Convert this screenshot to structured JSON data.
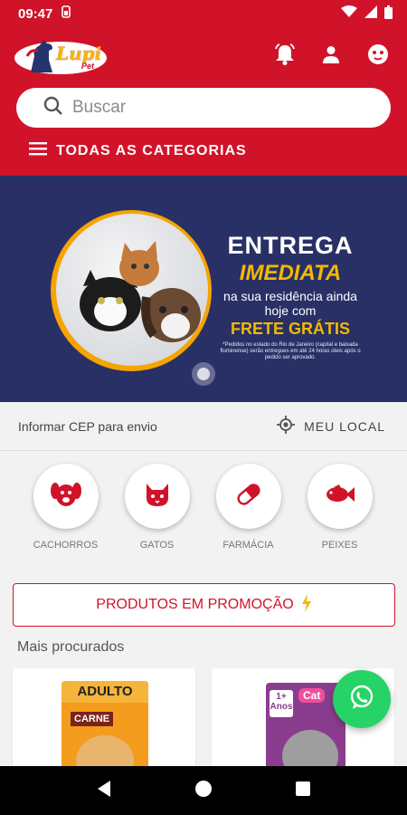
{
  "status": {
    "time": "09:47"
  },
  "brand": {
    "name": "Lupi",
    "suffix": "Pet"
  },
  "search": {
    "placeholder": "Buscar"
  },
  "menu": {
    "categories_label": "TODAS AS CATEGORIAS"
  },
  "banner": {
    "line1": "ENTREGA",
    "line2": "IMEDIATA",
    "line3": "na sua residência ainda hoje com",
    "line4": "FRETE GRÁTIS",
    "fine_print": "*Pedidos no estado do Rio de Janeiro (capital e baixada fluminense) serão entregues em até 24 horas úteis após o pedido ser aprovado."
  },
  "shipping": {
    "cep_label": "Informar CEP para envio",
    "location_label": "MEU LOCAL"
  },
  "categories": [
    {
      "label": "CACHORROS",
      "icon": "dog-icon"
    },
    {
      "label": "GATOS",
      "icon": "cat-icon"
    },
    {
      "label": "FARMÁCIA",
      "icon": "pill-icon"
    },
    {
      "label": "PEIXES",
      "icon": "fish-icon"
    }
  ],
  "promotions": {
    "label": "PRODUTOS EM PROMOÇÃO"
  },
  "most_searched": {
    "title": "Mais procurados"
  },
  "products": [
    {
      "pack_top": "ADULTO",
      "pack_flavor": "CARNE"
    },
    {
      "pack_badge": "1+ Anos",
      "pack_brand": "Cat"
    }
  ],
  "colors": {
    "primary": "#d1132a",
    "banner_bg": "#283066",
    "accent": "#f5b800",
    "whatsapp": "#25d366"
  }
}
